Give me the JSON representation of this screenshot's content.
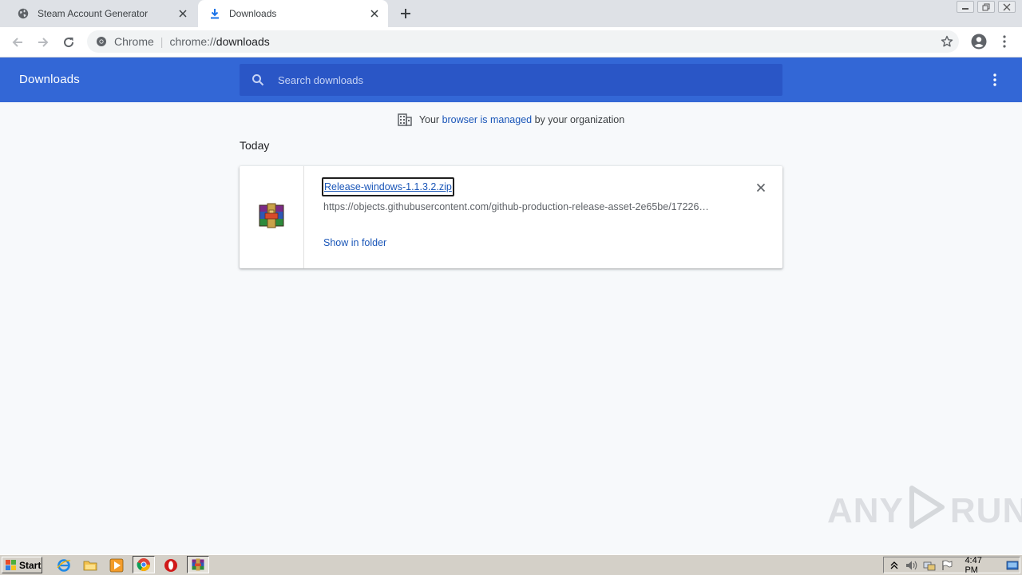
{
  "browser": {
    "tabs": [
      {
        "title": "Steam Account Generator",
        "icon": "globe-icon",
        "active": false
      },
      {
        "title": "Downloads",
        "icon": "download-icon",
        "active": true
      }
    ],
    "omnibox": {
      "site_label": "Chrome",
      "url_scheme": "chrome://",
      "url_host": "downloads"
    }
  },
  "downloads": {
    "header_title": "Downloads",
    "search_placeholder": "Search downloads",
    "managed_notice": {
      "prefix": "Your ",
      "link_text": "browser is managed",
      "suffix": " by your organization"
    },
    "section_label": "Today",
    "items": [
      {
        "filename": "Release-windows-1.1.3.2.zip",
        "url": "https://objects.githubusercontent.com/github-production-release-asset-2e65be/17226…",
        "action_label": "Show in folder",
        "icon": "winrar-archive-icon"
      }
    ]
  },
  "watermark": {
    "left": "ANY",
    "right": "RUN"
  },
  "taskbar": {
    "start_label": "Start",
    "clock": "4:47 PM"
  },
  "colors": {
    "header_blue": "#3367d6",
    "search_blue": "#2a56c6",
    "link_blue": "#1a56b8",
    "page_bg": "#f7f9fb"
  }
}
